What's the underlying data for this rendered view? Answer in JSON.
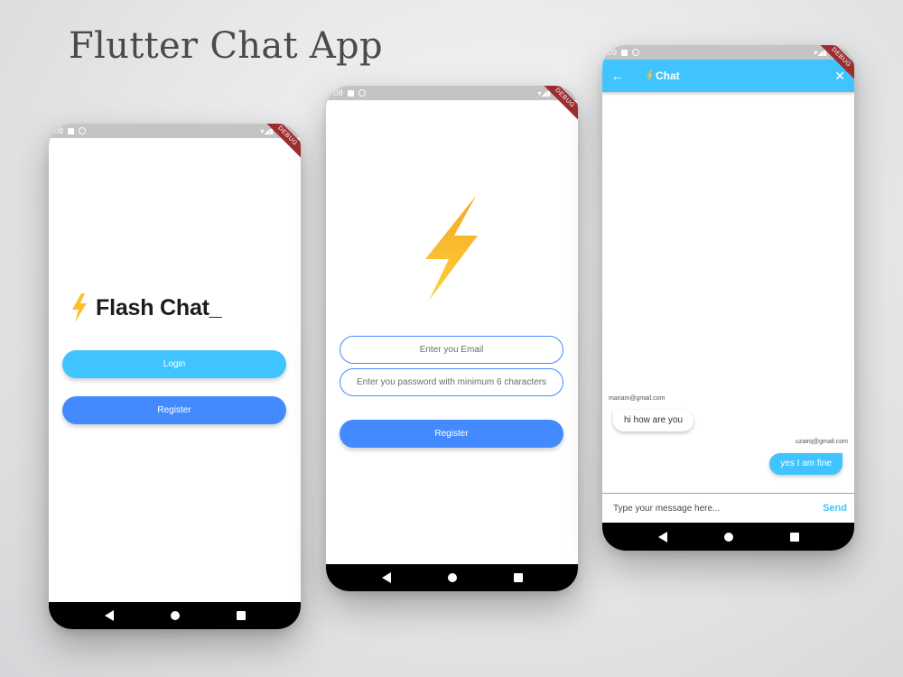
{
  "title": "Flutter Chat App",
  "colors": {
    "light_blue": "#40c4ff",
    "blue": "#448aff",
    "bolt": "#fbc02d"
  },
  "screens": [
    {
      "status_time": "08",
      "ribbon": "DEBUG",
      "brand": {
        "icon": "lightning-bolt-icon",
        "text": "Flash Chat_"
      },
      "login_label": "Login",
      "register_label": "Register"
    },
    {
      "status_time": ":08",
      "ribbon": "DEBUG",
      "email_placeholder": "Enter you Email",
      "password_placeholder": "Enter you password with minimum 6 characters",
      "register_label": "Register"
    },
    {
      "status_time": "09",
      "ribbon": "DEBUG",
      "appbar": {
        "back_icon": "arrow-left-icon",
        "title": "Chat",
        "close_icon": "close-icon"
      },
      "messages": [
        {
          "sender": "mariam@gmail.com",
          "text": "hi how are you",
          "is_me": false
        },
        {
          "sender": "uzairq@gmail.com",
          "text": "yes I am fine",
          "is_me": true
        }
      ],
      "composer": {
        "placeholder": "Type your message here...",
        "send_label": "Send"
      }
    }
  ]
}
